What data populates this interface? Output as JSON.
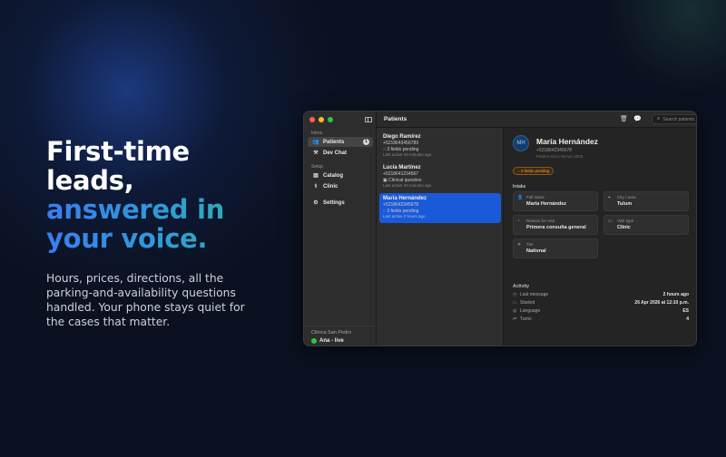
{
  "hero": {
    "line1": "First-time",
    "line2": "leads,",
    "line3": "answered in",
    "line4": "your voice.",
    "body": "Hours, prices, directions, all the parking-and-availability questions handled. Your phone stays quiet for the cases that matter."
  },
  "sidebar": {
    "inbox_header": "Inbox",
    "patients_label": "Patients",
    "patients_badge": "1",
    "devchat_label": "Dev Chat",
    "setup_header": "Setup",
    "catalog_label": "Catalog",
    "clinic_label": "Clinic",
    "settings_label": "Settings",
    "clinic_name": "Clinica San Pedro",
    "user_status": "Ana - live"
  },
  "titlebar": {
    "title": "Patients",
    "search_placeholder": "Search patients"
  },
  "patients": [
    {
      "name": "Diego Ramírez",
      "phone": "+5218643456789",
      "status": "3 fields pending",
      "last": "Last active 19 minutes ago"
    },
    {
      "name": "Lucía Martínez",
      "phone": "+5218641234567",
      "status": "Clinical question",
      "last": "Last active 33 minutes ago"
    },
    {
      "name": "María Hernández",
      "phone": "+5218642345678",
      "status": "3 fields pending",
      "last": "Last active 2 hours ago"
    }
  ],
  "detail": {
    "initials": "MH",
    "name": "María Hernández",
    "phone": "+5218642345678",
    "since": "Patient since 26 Apr 2026",
    "pending_badge": "3 fields pending",
    "intake_header": "Intake",
    "intake": [
      {
        "label": "Full name",
        "value": "María Hernández",
        "icon": "person-icon"
      },
      {
        "label": "City / area",
        "value": "Tulum",
        "icon": "location-icon"
      },
      {
        "label": "Reason for visit",
        "value": "Primera consulta general",
        "icon": "chat-icon"
      },
      {
        "label": "Visit type",
        "value": "Clinic",
        "icon": "clinic-icon"
      },
      {
        "label": "Tier",
        "value": "National",
        "icon": "plane-icon"
      }
    ],
    "activity_header": "Activity",
    "activity": [
      {
        "label": "Last message",
        "value": "2 hours ago",
        "icon": "clock-icon"
      },
      {
        "label": "Started",
        "value": "26 Apr 2026 at 12:10 p.m.",
        "icon": "calendar-icon"
      },
      {
        "label": "Language",
        "value": "ES",
        "icon": "globe-icon"
      },
      {
        "label": "Turns",
        "value": "4",
        "icon": "turns-icon"
      }
    ]
  },
  "colors": {
    "accent": "#1a5ad8",
    "pending": "#f0a040",
    "live": "#28c840"
  }
}
